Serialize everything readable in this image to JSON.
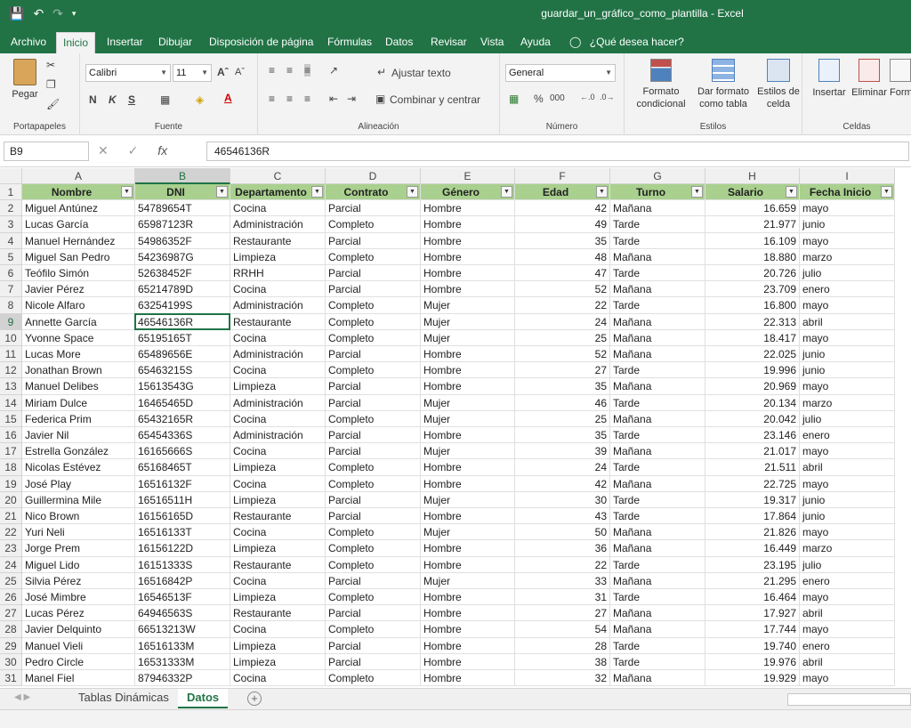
{
  "window": {
    "title": "guardar_un_gráfico_como_plantilla  -  Excel",
    "accent": "#217346"
  },
  "menu": {
    "tabs": [
      "Archivo",
      "Inicio",
      "Insertar",
      "Dibujar",
      "Disposición de página",
      "Fórmulas",
      "Datos",
      "Revisar",
      "Vista",
      "Ayuda"
    ],
    "active": "Inicio",
    "tell_me": "¿Qué desea hacer?"
  },
  "ribbon": {
    "clipboard": {
      "paste": "Pegar",
      "label": "Portapapeles"
    },
    "font": {
      "name": "Calibri",
      "size": "11",
      "bold": "N",
      "italic": "K",
      "underline": "S",
      "label": "Fuente"
    },
    "alignment": {
      "wrap": "Ajustar texto",
      "merge": "Combinar y centrar",
      "label": "Alineación"
    },
    "number": {
      "format": "General",
      "percent": "%",
      "thousands": "000",
      "label": "Número"
    },
    "styles": {
      "conditional": "Formato condicional",
      "table": "Dar formato como tabla",
      "cell_styles": "Estilos de celda",
      "label": "Estilos"
    },
    "cells": {
      "insert": "Insertar",
      "delete": "Eliminar",
      "format": "Form",
      "label": "Celdas"
    }
  },
  "formula_bar": {
    "name_box": "B9",
    "fx": "fx",
    "value": "46546136R"
  },
  "grid": {
    "columns": [
      "A",
      "B",
      "C",
      "D",
      "E",
      "F",
      "G",
      "H",
      "I"
    ],
    "selected_column": "B",
    "selected_row": 9,
    "headers": [
      "Nombre",
      "DNI",
      "Departamento",
      "Contrato",
      "Género",
      "Edad",
      "Turno",
      "Salario",
      "Fecha Inicio"
    ],
    "header_color": "#a9d08e",
    "rows": [
      [
        "Miguel Antúnez",
        "54789654T",
        "Cocina",
        "Parcial",
        "Hombre",
        "42",
        "Mañana",
        "16.659",
        "mayo"
      ],
      [
        "Lucas García",
        "65987123R",
        "Administración",
        "Completo",
        "Hombre",
        "49",
        "Tarde",
        "21.977",
        "junio"
      ],
      [
        "Manuel Hernández",
        "54986352F",
        "Restaurante",
        "Parcial",
        "Hombre",
        "35",
        "Tarde",
        "16.109",
        "mayo"
      ],
      [
        "Miguel San Pedro",
        "54236987G",
        "Limpieza",
        "Completo",
        "Hombre",
        "48",
        "Mañana",
        "18.880",
        "marzo"
      ],
      [
        "Teófilo Simón",
        "52638452F",
        "RRHH",
        "Parcial",
        "Hombre",
        "47",
        "Tarde",
        "20.726",
        "julio"
      ],
      [
        "Javier Pérez",
        "65214789D",
        "Cocina",
        "Parcial",
        "Hombre",
        "52",
        "Mañana",
        "23.709",
        "enero"
      ],
      [
        "Nicole Alfaro",
        "63254199S",
        "Administración",
        "Completo",
        "Mujer",
        "22",
        "Tarde",
        "16.800",
        "mayo"
      ],
      [
        "Annette García",
        "46546136R",
        "Restaurante",
        "Completo",
        "Mujer",
        "24",
        "Mañana",
        "22.313",
        "abril"
      ],
      [
        "Yvonne Space",
        "65195165T",
        "Cocina",
        "Completo",
        "Mujer",
        "25",
        "Mañana",
        "18.417",
        "mayo"
      ],
      [
        "Lucas More",
        "65489656E",
        "Administración",
        "Parcial",
        "Hombre",
        "52",
        "Mañana",
        "22.025",
        "junio"
      ],
      [
        "Jonathan Brown",
        "65463215S",
        "Cocina",
        "Completo",
        "Hombre",
        "27",
        "Tarde",
        "19.996",
        "junio"
      ],
      [
        "Manuel Delibes",
        "15613543G",
        "Limpieza",
        "Parcial",
        "Hombre",
        "35",
        "Mañana",
        "20.969",
        "mayo"
      ],
      [
        "Miriam Dulce",
        "16465465D",
        "Administración",
        "Parcial",
        "Mujer",
        "46",
        "Tarde",
        "20.134",
        "marzo"
      ],
      [
        "Federica Prim",
        "65432165R",
        "Cocina",
        "Completo",
        "Mujer",
        "25",
        "Mañana",
        "20.042",
        "julio"
      ],
      [
        "Javier Nil",
        "65454336S",
        "Administración",
        "Parcial",
        "Hombre",
        "35",
        "Tarde",
        "23.146",
        "enero"
      ],
      [
        "Estrella González",
        "16165666S",
        "Cocina",
        "Parcial",
        "Mujer",
        "39",
        "Mañana",
        "21.017",
        "mayo"
      ],
      [
        "Nicolas Estévez",
        "65168465T",
        "Limpieza",
        "Completo",
        "Hombre",
        "24",
        "Tarde",
        "21.511",
        "abril"
      ],
      [
        "José Play",
        "16516132F",
        "Cocina",
        "Completo",
        "Hombre",
        "42",
        "Mañana",
        "22.725",
        "mayo"
      ],
      [
        "Guillermina Mile",
        "16516511H",
        "Limpieza",
        "Parcial",
        "Mujer",
        "30",
        "Tarde",
        "19.317",
        "junio"
      ],
      [
        "Nico Brown",
        "16156165D",
        "Restaurante",
        "Parcial",
        "Hombre",
        "43",
        "Tarde",
        "17.864",
        "junio"
      ],
      [
        "Yuri Neli",
        "16516133T",
        "Cocina",
        "Completo",
        "Mujer",
        "50",
        "Mañana",
        "21.826",
        "mayo"
      ],
      [
        "Jorge Prem",
        "16156122D",
        "Limpieza",
        "Completo",
        "Hombre",
        "36",
        "Mañana",
        "16.449",
        "marzo"
      ],
      [
        "Miguel Lido",
        "16151333S",
        "Restaurante",
        "Completo",
        "Hombre",
        "22",
        "Tarde",
        "23.195",
        "julio"
      ],
      [
        "Silvia Pérez",
        "16516842P",
        "Cocina",
        "Parcial",
        "Mujer",
        "33",
        "Mañana",
        "21.295",
        "enero"
      ],
      [
        "José Mimbre",
        "16546513F",
        "Limpieza",
        "Completo",
        "Hombre",
        "31",
        "Tarde",
        "16.464",
        "mayo"
      ],
      [
        "Lucas Pérez",
        "64946563S",
        "Restaurante",
        "Parcial",
        "Hombre",
        "27",
        "Mañana",
        "17.927",
        "abril"
      ],
      [
        "Javier Delquinto",
        "66513213W",
        "Cocina",
        "Completo",
        "Hombre",
        "54",
        "Mañana",
        "17.744",
        "mayo"
      ],
      [
        "Manuel Vieli",
        "16516133M",
        "Limpieza",
        "Parcial",
        "Hombre",
        "28",
        "Tarde",
        "19.740",
        "enero"
      ],
      [
        "Pedro Circle",
        "16531333M",
        "Limpieza",
        "Parcial",
        "Hombre",
        "38",
        "Tarde",
        "19.976",
        "abril"
      ],
      [
        "Manel Fiel",
        "87946332P",
        "Cocina",
        "Completo",
        "Hombre",
        "32",
        "Mañana",
        "19.929",
        "mayo"
      ]
    ]
  },
  "sheets": {
    "tabs": [
      "Tablas Dinámicas",
      "Datos"
    ],
    "active": "Datos"
  }
}
